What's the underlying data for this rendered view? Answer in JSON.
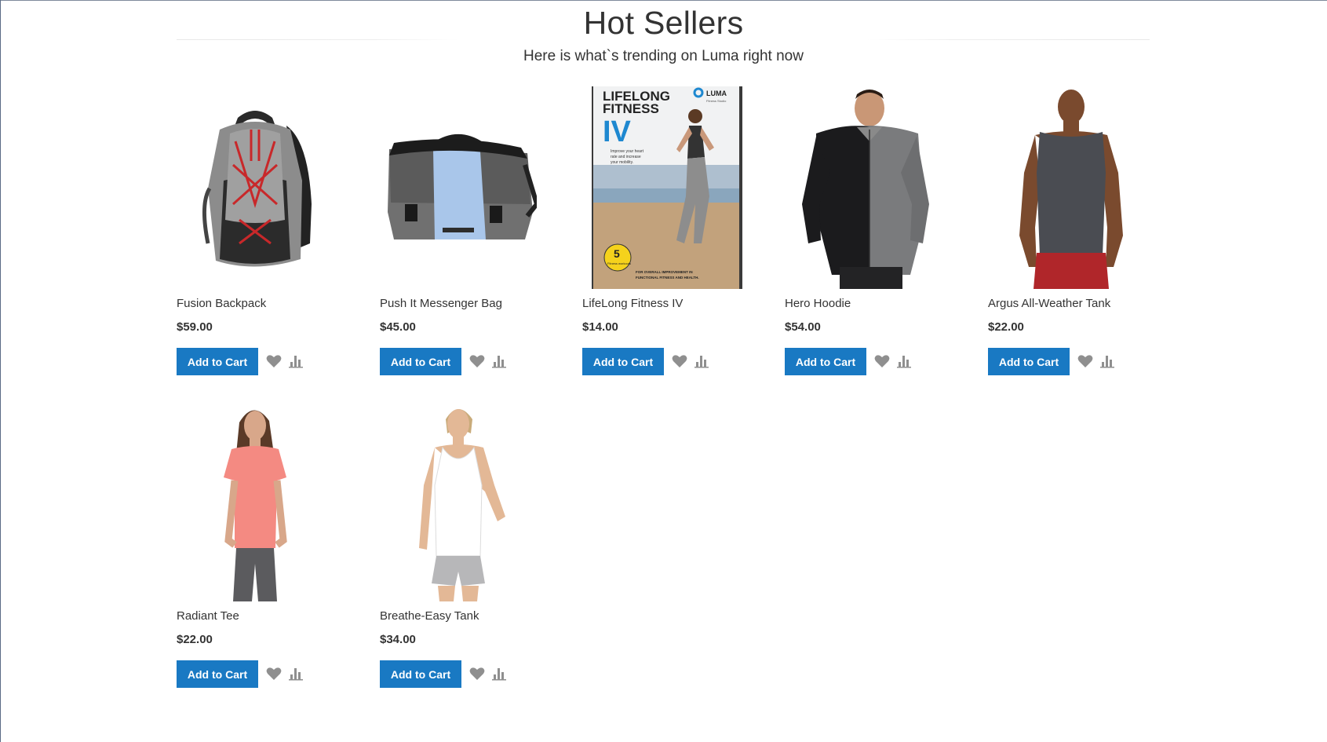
{
  "section": {
    "title": "Hot Sellers",
    "subtitle": "Here is what`s trending on Luma right now"
  },
  "products": [
    {
      "name": "Fusion Backpack",
      "price": "$59.00",
      "button_label": "Add to Cart"
    },
    {
      "name": "Push It Messenger Bag",
      "price": "$45.00",
      "button_label": "Add to Cart"
    },
    {
      "name": "LifeLong Fitness IV",
      "price": "$14.00",
      "button_label": "Add to Cart",
      "cover": {
        "title_line1": "LIFELONG",
        "title_line2": "FITNESS",
        "numeral": "IV",
        "brand": "LUMA",
        "brand_sub": "Fitness Studio",
        "tagline": [
          "Improve your heart",
          "rate and increase",
          "your mobility."
        ],
        "badge_number": "5",
        "badge_text": "Fitness workouts",
        "footer": [
          "FOR OVERALL IMPROVEMENT IN",
          "FUNCTIONAL FITNESS AND HEALTH."
        ]
      }
    },
    {
      "name": "Hero Hoodie",
      "price": "$54.00",
      "button_label": "Add to Cart"
    },
    {
      "name": "Argus All-Weather Tank",
      "price": "$22.00",
      "button_label": "Add to Cart"
    },
    {
      "name": "Radiant Tee",
      "price": "$22.00",
      "button_label": "Add to Cart"
    },
    {
      "name": "Breathe-Easy Tank",
      "price": "$34.00",
      "button_label": "Add to Cart"
    }
  ],
  "icons": {
    "wishlist": "heart-icon",
    "compare": "compare-icon"
  },
  "colors": {
    "button_primary": "#1979c3",
    "icon_gray": "#8f8f8f",
    "text": "#333333"
  }
}
